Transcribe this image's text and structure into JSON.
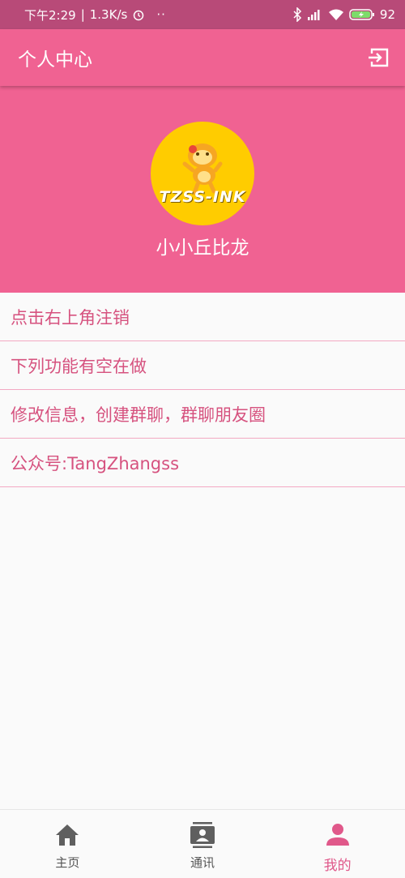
{
  "status_bar": {
    "time": "下午2:29",
    "speed": "1.3K/s",
    "dots": "··",
    "battery": "92"
  },
  "toolbar": {
    "title": "个人中心"
  },
  "profile": {
    "avatar_text": "TZSS-INK",
    "username": "小小丘比龙"
  },
  "menu": {
    "items": [
      {
        "label": "点击右上角注销"
      },
      {
        "label": "下列功能有空在做"
      },
      {
        "label": "修改信息，创建群聊，群聊朋友圈"
      },
      {
        "label": "公众号:TangZhangss"
      }
    ]
  },
  "bottom_nav": {
    "items": [
      {
        "label": "主页",
        "icon": "home-icon"
      },
      {
        "label": "通讯",
        "icon": "contacts-icon"
      },
      {
        "label": "我的",
        "icon": "person-icon",
        "active": true
      }
    ]
  },
  "colors": {
    "primary": "#f06292",
    "status_bar": "#b84a78",
    "accent_text": "#d6527f",
    "divider": "#f3a9c3"
  }
}
